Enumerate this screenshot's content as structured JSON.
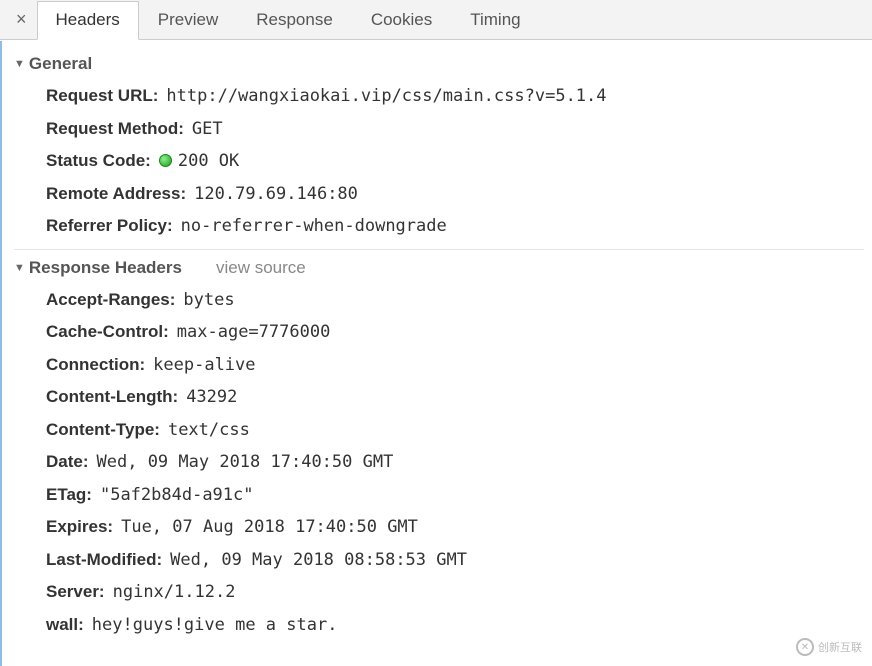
{
  "tabs": {
    "close": "×",
    "items": [
      "Headers",
      "Preview",
      "Response",
      "Cookies",
      "Timing"
    ],
    "active": 0
  },
  "sections": {
    "general": {
      "title": "General",
      "rows": {
        "request_url": {
          "k": "Request URL:",
          "v": "http://wangxiaokai.vip/css/main.css?v=5.1.4"
        },
        "request_method": {
          "k": "Request Method:",
          "v": "GET"
        },
        "status_code": {
          "k": "Status Code:",
          "v": "200 OK"
        },
        "remote_address": {
          "k": "Remote Address:",
          "v": "120.79.69.146:80"
        },
        "referrer_policy": {
          "k": "Referrer Policy:",
          "v": "no-referrer-when-downgrade"
        }
      }
    },
    "response_headers": {
      "title": "Response Headers",
      "view_source": "view source",
      "rows": {
        "accept_ranges": {
          "k": "Accept-Ranges:",
          "v": "bytes"
        },
        "cache_control": {
          "k": "Cache-Control:",
          "v": "max-age=7776000"
        },
        "connection": {
          "k": "Connection:",
          "v": "keep-alive"
        },
        "content_length": {
          "k": "Content-Length:",
          "v": "43292"
        },
        "content_type": {
          "k": "Content-Type:",
          "v": "text/css"
        },
        "date": {
          "k": "Date:",
          "v": "Wed, 09 May 2018 17:40:50 GMT"
        },
        "etag": {
          "k": "ETag:",
          "v": "\"5af2b84d-a91c\""
        },
        "expires": {
          "k": "Expires:",
          "v": "Tue, 07 Aug 2018 17:40:50 GMT"
        },
        "last_modified": {
          "k": "Last-Modified:",
          "v": "Wed, 09 May 2018 08:58:53 GMT"
        },
        "server": {
          "k": "Server:",
          "v": "nginx/1.12.2"
        },
        "wall": {
          "k": "wall:",
          "v": "hey!guys!give me a star."
        }
      }
    }
  },
  "watermark": "创新互联"
}
